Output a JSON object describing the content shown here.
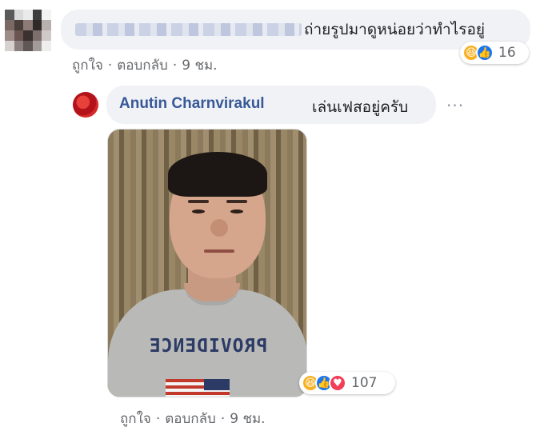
{
  "comment_1": {
    "text": "ถ่ายรูปมาดูหน่อยว่าทำไรอยู่",
    "reaction_icons": [
      "haha-icon",
      "like-icon"
    ],
    "reaction_count": "16",
    "actions": {
      "like": "ถูกใจ",
      "separator": "·",
      "reply": "ตอบกลับ",
      "time": "9 ชม."
    }
  },
  "comment_2": {
    "author": "Anutin Charnvirakul",
    "text": "เล่นเฟสอยู่ครับ",
    "more_options": "···",
    "photo": {
      "shirt_text": "PROVIDENCE"
    },
    "reaction_icons": [
      "haha-icon",
      "like-icon",
      "love-icon"
    ],
    "reaction_count": "107",
    "actions": {
      "like": "ถูกใจ",
      "separator": "·",
      "reply": "ตอบกลับ",
      "time": "9 ชม."
    }
  },
  "colors": {
    "bubble": "#f0f2f5",
    "author": "#385898",
    "meta": "#65676b",
    "like": "#1877f2",
    "haha": "#f7b125",
    "love": "#f33e58"
  }
}
